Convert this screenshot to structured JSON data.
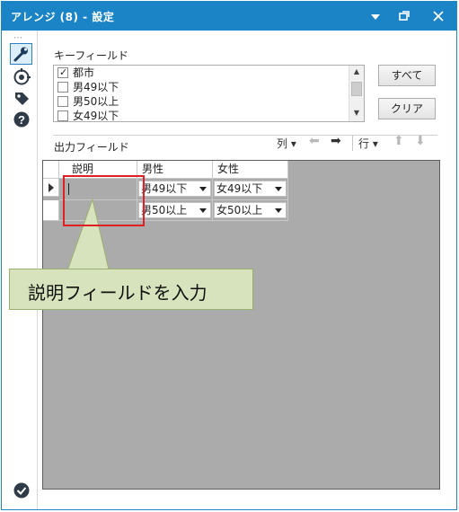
{
  "window": {
    "title": "アレンジ (8) - 設定",
    "controls": [
      "dropdown-icon",
      "restore-icon",
      "close-icon"
    ]
  },
  "sidebar": {
    "items": [
      "wrench-icon",
      "target-icon",
      "tag-icon",
      "help-icon"
    ],
    "bottom_icon": "check-circle-icon"
  },
  "key_fields": {
    "label": "キーフィールド",
    "items": [
      {
        "label": "都市",
        "checked": true
      },
      {
        "label": "男49以下",
        "checked": false
      },
      {
        "label": "男50以上",
        "checked": false
      },
      {
        "label": "女49以下",
        "checked": false
      }
    ],
    "select_all_label": "すべて",
    "clear_label": "クリア"
  },
  "output_fields": {
    "label": "出力フィールド",
    "toolbar": {
      "column_label": "列",
      "row_label": "行"
    },
    "headers": [
      "説明",
      "男性",
      "女性"
    ],
    "rows": [
      {
        "description": "",
        "male": "男49以下",
        "female": "女49以下"
      },
      {
        "description": "",
        "male": "男50以上",
        "female": "女50以上"
      }
    ]
  },
  "callout": {
    "text": "説明フィールドを入力"
  },
  "colors": {
    "titlebar": "#1a84c7",
    "highlight": "#e02020",
    "callout_bg": "#d6e3bc"
  }
}
